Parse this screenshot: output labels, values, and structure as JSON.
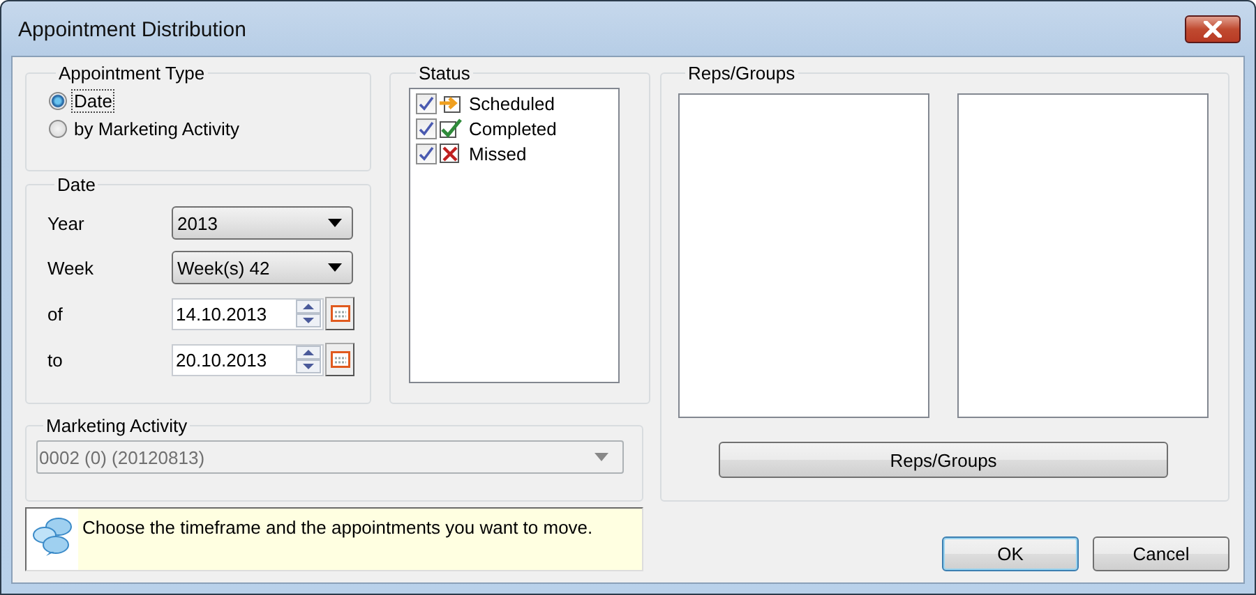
{
  "window": {
    "title": "Appointment Distribution"
  },
  "appointment_type": {
    "label": "Appointment Type",
    "options": [
      {
        "label": "Date",
        "selected": true
      },
      {
        "label": "by Marketing Activity",
        "selected": false
      }
    ]
  },
  "date": {
    "label": "Date",
    "fields": [
      {
        "kind": "dropdown",
        "label": "Year",
        "value": "2013"
      },
      {
        "kind": "dropdown",
        "label": "Week",
        "value": "Week(s) 42"
      },
      {
        "kind": "date",
        "label": "of",
        "value": "14.10.2013"
      },
      {
        "kind": "date",
        "label": "to",
        "value": "20.10.2013"
      }
    ]
  },
  "status": {
    "label": "Status",
    "items": [
      {
        "kind": "scheduled",
        "label": "Scheduled",
        "checked": true
      },
      {
        "kind": "completed",
        "label": "Completed",
        "checked": true
      },
      {
        "kind": "missed",
        "label": "Missed",
        "checked": true
      }
    ]
  },
  "marketing_activity": {
    "label": "Marketing Activity",
    "value": "0002 (0) (20120813)",
    "disabled": true
  },
  "help": {
    "text": "Choose the timeframe and the appointments you want to move."
  },
  "reps_groups": {
    "label": "Reps/Groups",
    "button": "Reps/Groups"
  },
  "buttons": [
    {
      "label": "OK",
      "default": true
    },
    {
      "label": "Cancel",
      "default": false
    }
  ]
}
